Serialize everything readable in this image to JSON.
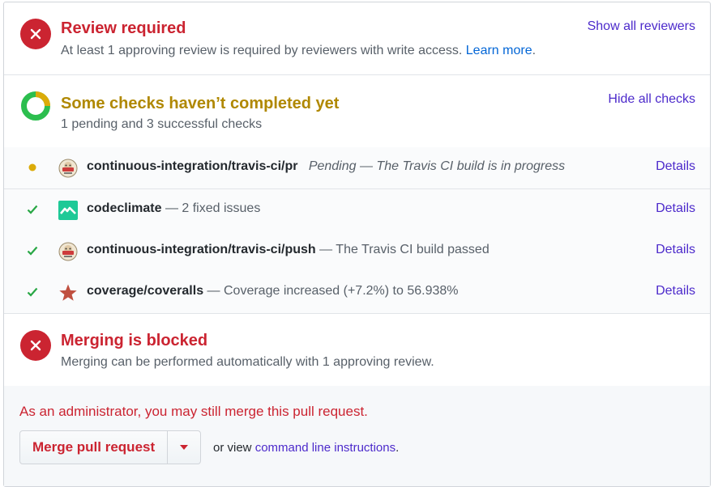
{
  "review": {
    "title": "Review required",
    "subtitle": "At least 1 approving review is required by reviewers with write access.",
    "learn_more": "Learn more",
    "period": ".",
    "show_reviewers": "Show all reviewers",
    "title_color": "#cb2431"
  },
  "checks": {
    "title": "Some checks haven’t completed yet",
    "subtitle": "1 pending and 3 successful checks",
    "hide_checks": "Hide all checks",
    "title_color": "#b08800",
    "items": [
      {
        "status": "pending",
        "icon": "travis-ci-logo-icon",
        "name": "continuous-integration/travis-ci/pr",
        "description": "Pending — The Travis CI build is in progress",
        "details": "Details"
      },
      {
        "status": "success",
        "icon": "codeclimate-logo-icon",
        "name": "codeclimate",
        "description": "— 2 fixed issues",
        "details": "Details"
      },
      {
        "status": "success",
        "icon": "travis-ci-logo-icon",
        "name": "continuous-integration/travis-ci/push",
        "description": "— The Travis CI build passed",
        "details": "Details"
      },
      {
        "status": "success",
        "icon": "coveralls-star-icon",
        "name": "coverage/coveralls",
        "description": "— Coverage increased (+7.2%) to 56.938%",
        "details": "Details"
      }
    ]
  },
  "merge_blocked": {
    "title": "Merging is blocked",
    "subtitle": "Merging can be performed automatically with 1 approving review."
  },
  "merge": {
    "admin_note": "As an administrator, you may still merge this pull request.",
    "button_label": "Merge pull request",
    "or_view": "or view",
    "cli_link": "command line instructions",
    "period": "."
  }
}
